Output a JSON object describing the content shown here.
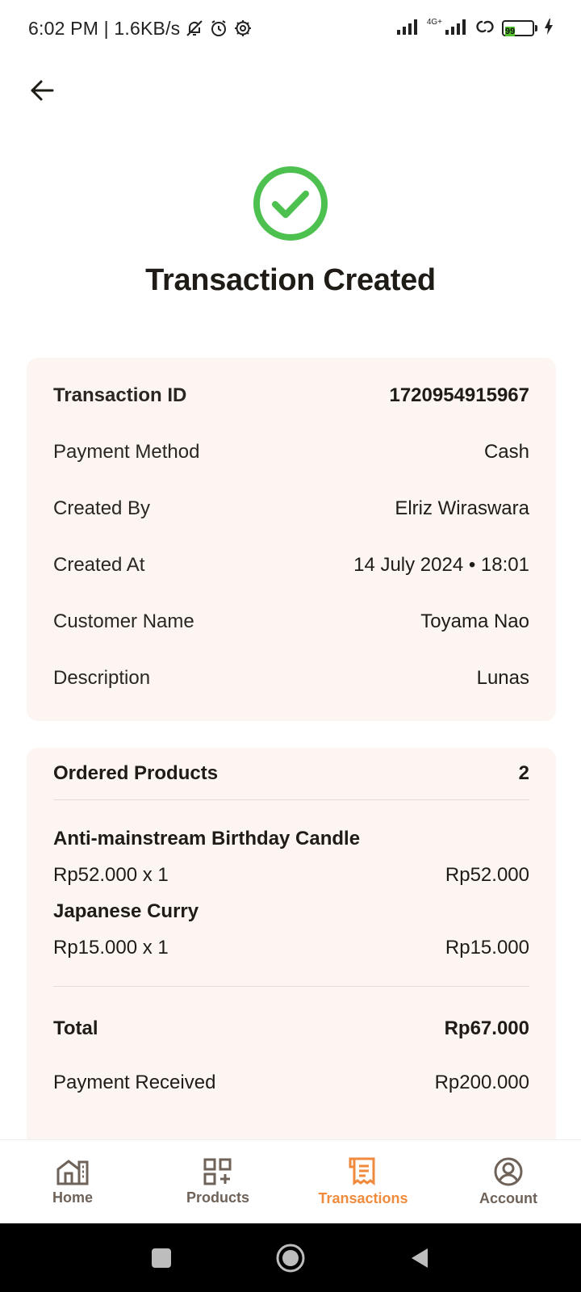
{
  "status_bar": {
    "time_speed": "6:02 PM | 1.6KB/s",
    "network_label": "4G+",
    "battery_level": "99"
  },
  "header": {
    "title": "Transaction Created"
  },
  "details": {
    "rows": [
      {
        "label": "Transaction ID",
        "value": "1720954915967"
      },
      {
        "label": "Payment Method",
        "value": "Cash"
      },
      {
        "label": "Created By",
        "value": "Elriz Wiraswara"
      },
      {
        "label": "Created At",
        "value": "14 July 2024 • 18:01"
      },
      {
        "label": "Customer Name",
        "value": "Toyama Nao"
      },
      {
        "label": "Description",
        "value": "Lunas"
      }
    ]
  },
  "order": {
    "title": "Ordered Products",
    "count": "2",
    "products": [
      {
        "name": "Anti-mainstream Birthday Candle",
        "qty_price": "Rp52.000 x 1",
        "subtotal": "Rp52.000"
      },
      {
        "name": "Japanese Curry",
        "qty_price": "Rp15.000 x 1",
        "subtotal": "Rp15.000"
      }
    ],
    "total_label": "Total",
    "total_value": "Rp67.000",
    "payment_received_label": "Payment Received",
    "payment_received_value": "Rp200.000"
  },
  "bottom_nav": {
    "items": [
      {
        "label": "Home",
        "icon": "home-icon"
      },
      {
        "label": "Products",
        "icon": "products-icon"
      },
      {
        "label": "Transactions",
        "icon": "transactions-icon"
      },
      {
        "label": "Account",
        "icon": "account-icon"
      }
    ],
    "active": "Transactions"
  },
  "colors": {
    "accent": "#f08a3c",
    "success": "#4cc150",
    "card_bg": "#fdf5f1"
  }
}
